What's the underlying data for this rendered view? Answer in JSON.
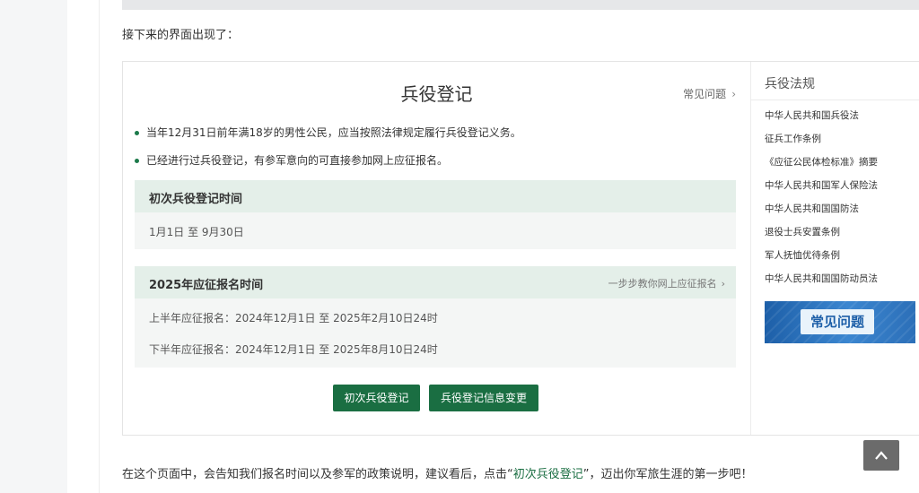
{
  "article": {
    "intro": "接下来的界面出现了：",
    "outro_before": "在这个页面中，会告知我们报名时间以及参军的政策说明，建议看后，点击“",
    "outro_link": "初次兵役登记",
    "outro_after": "”，迈出你军旅生涯的第一步吧！"
  },
  "panel": {
    "title": "兵役登记",
    "faq_link": "常见问题",
    "bullets": [
      "当年12月31日前年满18岁的男性公民，应当按照法律规定履行兵役登记义务。",
      "已经进行过兵役登记，有参军意向的可直接参加网上应征报名。"
    ],
    "section1": {
      "title": "初次兵役登记时间",
      "rows": [
        "1月1日 至 9月30日"
      ]
    },
    "section2": {
      "title": "2025年应征报名时间",
      "link": "一步步教你网上应征报名",
      "rows": [
        "上半年应征报名：2024年12月1日 至 2025年2月10日24时",
        "下半年应征报名：2024年12月1日 至 2025年8月10日24时"
      ]
    },
    "buttons": {
      "first_registration": "初次兵役登记",
      "info_change": "兵役登记信息变更"
    }
  },
  "sidebar": {
    "title": "兵役法规",
    "items": [
      "中华人民共和国兵役法",
      "征兵工作条例",
      "《应征公民体检标准》摘要",
      "中华人民共和国军人保险法",
      "中华人民共和国国防法",
      "退役士兵安置条例",
      "军人抚恤优待条例",
      "中华人民共和国国防动员法"
    ],
    "banner_text": "常见问题"
  },
  "colors": {
    "accent_green": "#1a6e42",
    "section_head_bg": "#e4efe9",
    "banner_blue": "#1d5fa8"
  },
  "icons": {
    "chevron": "chevron-right-icon",
    "back_to_top": "arrow-up-icon"
  }
}
